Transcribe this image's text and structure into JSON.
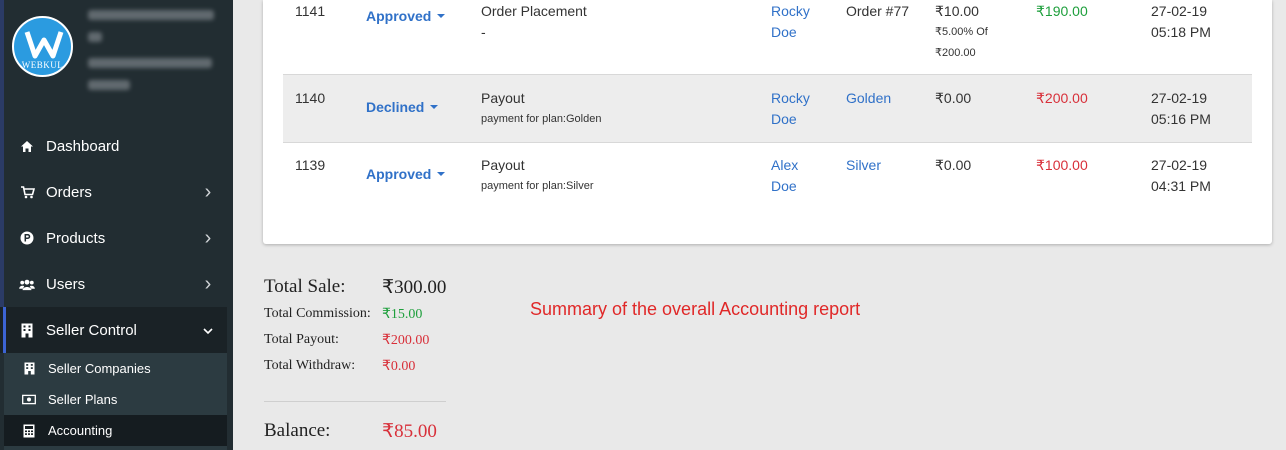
{
  "sidebar": {
    "logo_text": "WEBKUL",
    "nav": [
      {
        "label": "Dashboard",
        "icon": "home-icon",
        "has_chevron": false
      },
      {
        "label": "Orders",
        "icon": "cart-icon",
        "has_chevron": true
      },
      {
        "label": "Products",
        "icon": "product-icon",
        "has_chevron": true
      },
      {
        "label": "Users",
        "icon": "users-icon",
        "has_chevron": true
      },
      {
        "label": "Seller Control",
        "icon": "building-icon",
        "has_chevron": true,
        "expanded": true
      }
    ],
    "sub_nav": [
      {
        "label": "Seller Companies",
        "icon": "building-icon"
      },
      {
        "label": "Seller Plans",
        "icon": "money-icon"
      },
      {
        "label": "Accounting",
        "icon": "calculator-icon",
        "active": true
      }
    ],
    "chevron_right": "›",
    "chevron_down": "⌄"
  },
  "table": {
    "rows": [
      {
        "id": "1141",
        "status": "Approved",
        "type": "Order Placement",
        "type_sub": "-",
        "user_first": "Rocky",
        "user_last": "Doe",
        "reference": "Order #77",
        "commission": "₹10.00",
        "commission_note_1": "₹5.00% Of",
        "commission_note_2": "₹200.00",
        "amount": "₹190.00",
        "amount_color": "green",
        "date": "27-02-19",
        "time": "05:18 PM"
      },
      {
        "id": "1140",
        "status": "Declined",
        "type": "Payout",
        "type_sub": "payment for plan:Golden",
        "user_first": "Rocky",
        "user_last": "Doe",
        "reference": "Golden",
        "commission": "₹0.00",
        "amount": "₹200.00",
        "amount_color": "red",
        "date": "27-02-19",
        "time": "05:16 PM"
      },
      {
        "id": "1139",
        "status": "Approved",
        "type": "Payout",
        "type_sub": "payment for plan:Silver",
        "user_first": "Alex",
        "user_last": "Doe",
        "reference": "Silver",
        "commission": "₹0.00",
        "amount": "₹100.00",
        "amount_color": "red",
        "date": "27-02-19",
        "time": "04:31 PM"
      }
    ]
  },
  "summary": {
    "total_sale_label": "Total Sale:",
    "total_sale": "₹300.00",
    "total_commission_label": "Total Commission:",
    "total_commission": "₹15.00",
    "total_payout_label": "Total Payout:",
    "total_payout": "₹200.00",
    "total_withdraw_label": "Total Withdraw:",
    "total_withdraw": "₹0.00",
    "balance_label": "Balance:",
    "balance": "₹85.00"
  },
  "annotation": "Summary of the overall Accounting report",
  "colors": {
    "sidebar_bg": "#222d32",
    "accent_blue": "#3071c8",
    "positive_green": "#1e9f3c",
    "negative_red": "#d8303a"
  }
}
